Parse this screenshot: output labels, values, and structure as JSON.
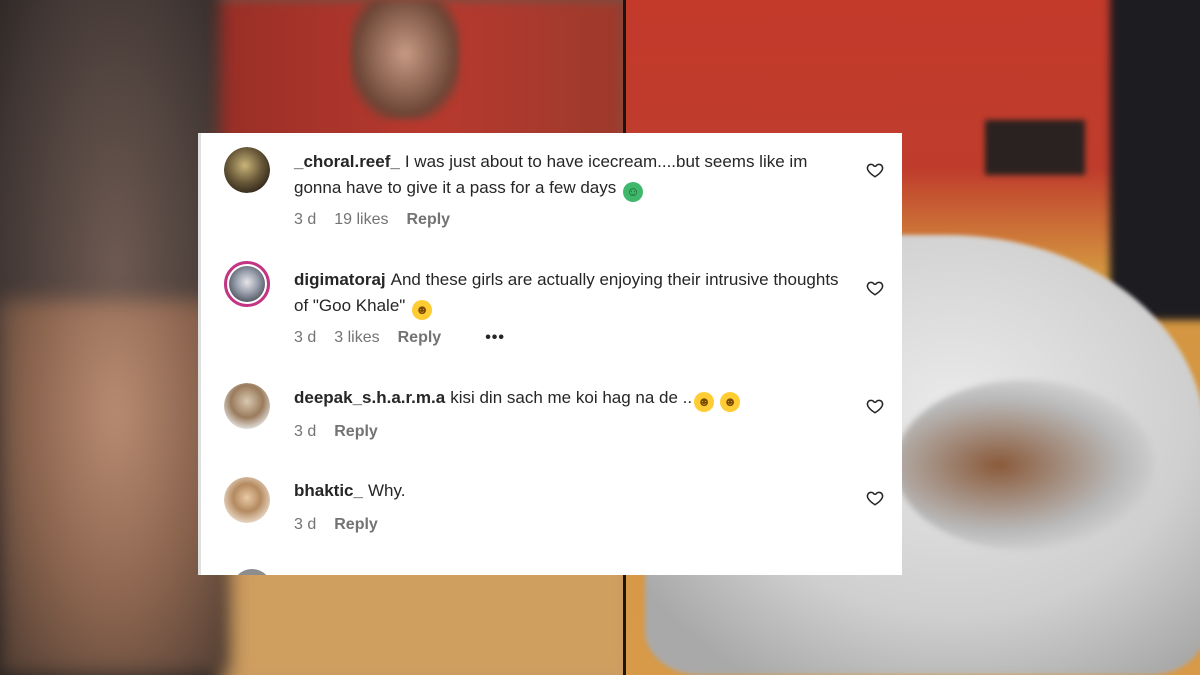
{
  "colors": {
    "card_background": "#ffffff",
    "text_primary": "#262626",
    "text_secondary": "#737373",
    "story_ring": "#c13584"
  },
  "comments": [
    {
      "username": "_choral.reef_",
      "text": "I was just about to have icecream....but seems like im gonna have to give it a pass for a few days",
      "emoji": "nauseated-face",
      "age": "3 d",
      "likes": "19 likes",
      "reply_label": "Reply",
      "has_story_ring": false
    },
    {
      "username": "digimatoraj",
      "text": "And these girls are actually enjoying their intrusive thoughts of \"Goo Khale\"",
      "emoji": "laughing-face",
      "age": "3 d",
      "likes": "3 likes",
      "reply_label": "Reply",
      "more_label": "•••",
      "has_story_ring": true
    },
    {
      "username": "deepak_s.h.a.r.m.a",
      "text": "kisi din sach me koi hag na de ..",
      "emoji": "laughing-face x2",
      "age": "3 d",
      "likes": "",
      "reply_label": "Reply",
      "has_story_ring": false
    },
    {
      "username": "bhaktic_",
      "text": "Why.",
      "emoji": "",
      "age": "3 d",
      "likes": "",
      "reply_label": "Reply",
      "has_story_ring": false
    }
  ],
  "icons": {
    "like": "heart-outline-icon",
    "more": "more-options-icon"
  }
}
